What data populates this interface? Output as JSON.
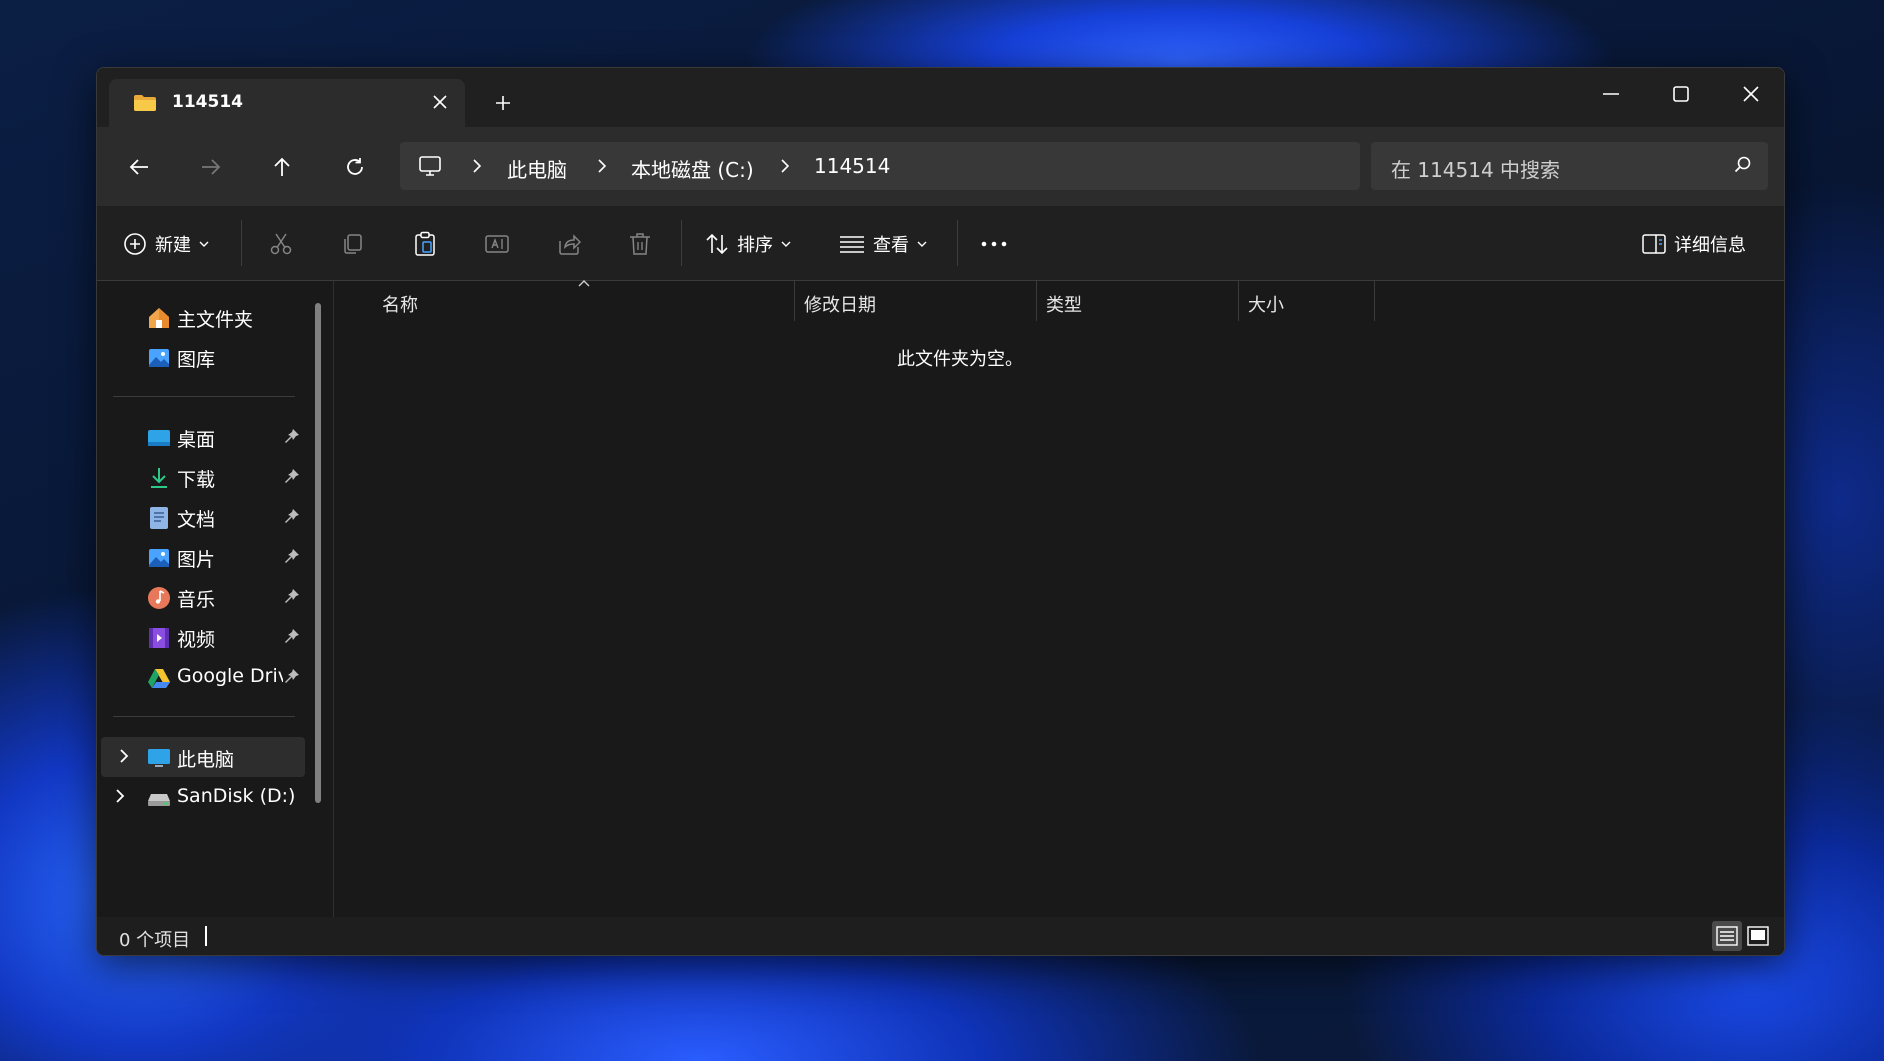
{
  "window": {
    "tab_title": "114514",
    "tab_close_label": "×",
    "new_tab_label": "+"
  },
  "address_bar": {
    "crumbs": [
      "此电脑",
      "本地磁盘 (C:)",
      "114514"
    ]
  },
  "search": {
    "placeholder": "在 114514 中搜索"
  },
  "toolbar": {
    "new_label": "新建",
    "sort_label": "排序",
    "view_label": "查看",
    "details_label": "详细信息"
  },
  "sidebar": {
    "top_items": [
      {
        "label": "主文件夹",
        "icon": "home-icon"
      },
      {
        "label": "图库",
        "icon": "gallery-icon"
      }
    ],
    "pinned_items": [
      {
        "label": "桌面",
        "icon": "desktop-icon"
      },
      {
        "label": "下载",
        "icon": "download-icon"
      },
      {
        "label": "文档",
        "icon": "documents-icon"
      },
      {
        "label": "图片",
        "icon": "pictures-icon"
      },
      {
        "label": "音乐",
        "icon": "music-icon"
      },
      {
        "label": "视频",
        "icon": "videos-icon"
      },
      {
        "label": "Google Drive",
        "icon": "google-drive-icon"
      }
    ],
    "drive_items": [
      {
        "label": "此电脑",
        "icon": "this-pc-icon",
        "selected": true
      },
      {
        "label": "SanDisk (D:)",
        "icon": "drive-icon"
      }
    ]
  },
  "columns": [
    "名称",
    "修改日期",
    "类型",
    "大小"
  ],
  "empty_message": "此文件夹为空。",
  "status": {
    "item_count": "0 个项目"
  },
  "colors": {
    "window_bg": "#191919",
    "titlebar_bg": "#202020",
    "navbar_bg": "#2c2c2c",
    "field_bg": "#383838",
    "folder_yellow": "#f7c948",
    "accent_blue": "#3a8dde"
  }
}
